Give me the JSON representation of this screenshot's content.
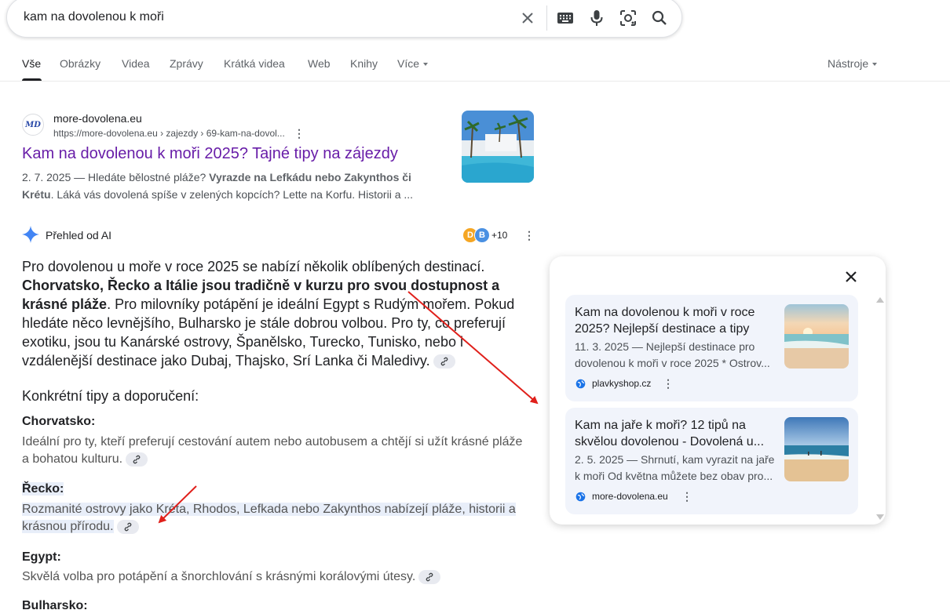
{
  "search": {
    "query": "kam na dovolenou k moři"
  },
  "tabs": [
    "Vše",
    "Obrázky",
    "Videa",
    "Zprávy",
    "Krátká videa",
    "Web",
    "Knihy",
    "Více"
  ],
  "tools": "Nástroje",
  "result": {
    "site": "more-dovolena.eu",
    "url": "https://more-dovolena.eu › zajezdy › 69-kam-na-dovol...",
    "title": "Kam na dovolenou k moři 2025? Tajné tipy na zájezdy",
    "snippet_pre": "2. 7. 2025 — Hledáte bělostné pláže? ",
    "snippet_bold": "Vyrazde na Lefkádu nebo Zakynthos či Krétu",
    "snippet_post": ". Láká vás dovolená spíše v zelených kopcích? Lette na Korfu. Historii a ..."
  },
  "ai": {
    "label": "Přehled od AI",
    "avatars": [
      "D",
      "B"
    ],
    "more_count": "+10",
    "para_1": "Pro dovolenou u moře v roce 2025 se nabízí několik oblíbených destinací. ",
    "para_bold": "Chorvatsko, Řecko a Itálie jsou tradičně v kurzu pro svou dostupnost a krásné pláže",
    "para_2": ". Pro milovníky potápění je ideální Egypt s Rudým mořem. Pokud hledáte něco levnějšího, Bulharsko je stále dobrou volbou. Pro ty, co preferují exotiku, jsou tu Kanárské ostrovy, Španělsko, Turecko, Tunisko, nebo i vzdálenější destinace jako Dubaj, Thajsko, Srí Lanka či Maledivy.",
    "tips_heading": "Konkrétní tipy a doporučení:",
    "sections": [
      {
        "h": "Chorvatsko:",
        "t": "Ideální pro ty, kteří preferují cestování autem nebo autobusem a chtějí si užít krásné pláže a bohatou kulturu."
      },
      {
        "h": "Řecko:",
        "t": "Rozmanité ostrovy jako Kréta, Rhodos, Lefkada nebo Zakynthos nabízejí pláže, historii a krásnou přírodu."
      },
      {
        "h": "Egypt:",
        "t": "Skvělá volba pro potápění a šnorchlování s krásnými korálovými útesy."
      },
      {
        "h": "Bulharsko:",
        "t": ""
      }
    ]
  },
  "panel": {
    "cards": [
      {
        "title": "Kam na dovolenou k moři v roce 2025? Nejlepší destinace a tipy",
        "snippet": "11. 3. 2025 — Nejlepší destinace pro dovolenou k moři v roce 2025 * Ostrov...",
        "source": "plavkyshop.cz"
      },
      {
        "title": "Kam na jaře k moři? 12 tipů na skvělou dovolenou - Dovolená u...",
        "snippet": "2. 5. 2025 — Shrnutí, kam vyrazit na jaře k moři Od května můžete bez obav pro...",
        "source": "more-dovolena.eu"
      }
    ]
  },
  "colors": {
    "link_visited": "#681da8",
    "annotation_arrow": "#e0201b",
    "ai_star": "#4285f4"
  }
}
